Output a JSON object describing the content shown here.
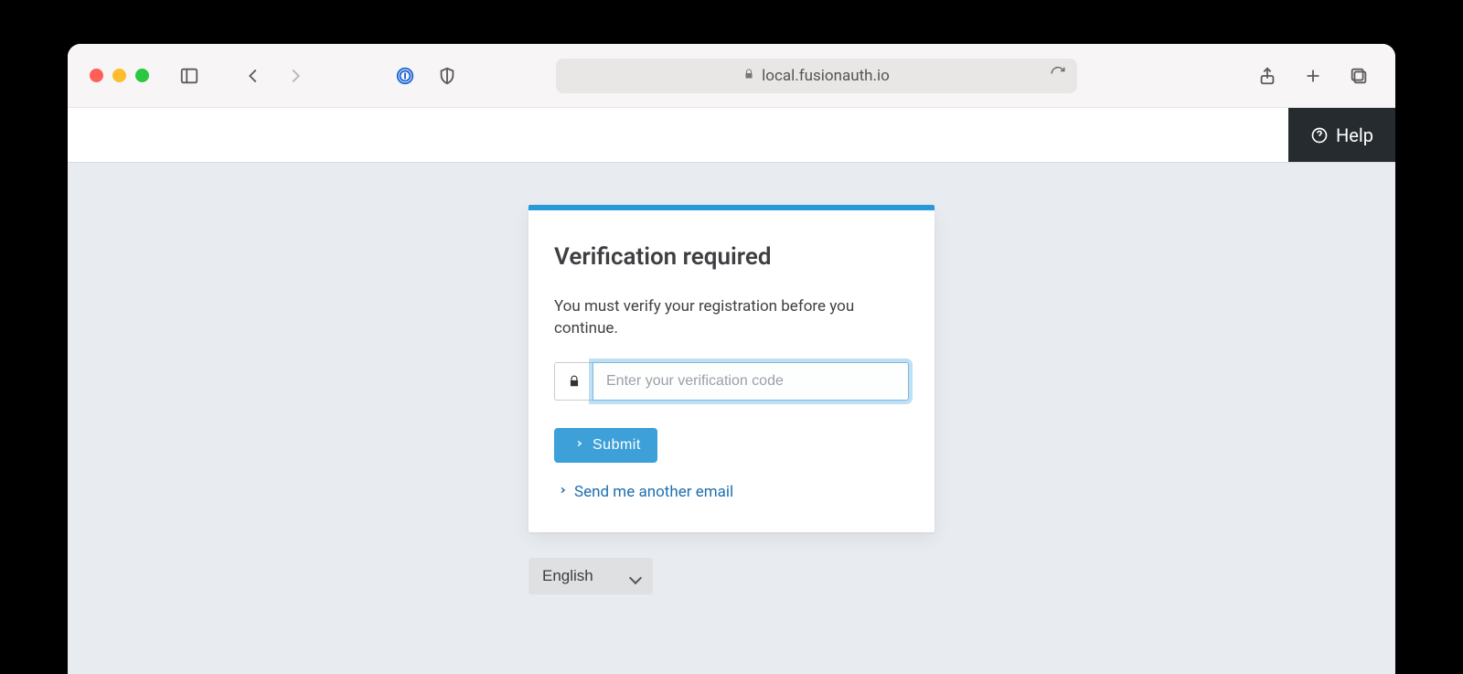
{
  "browser": {
    "url_display": "local.fusionauth.io"
  },
  "appbar": {
    "help_label": "Help"
  },
  "panel": {
    "title": "Verification required",
    "message": "You must verify your registration before you continue.",
    "code_placeholder": "Enter your verification code",
    "code_value": "",
    "submit_label": "Submit",
    "resend_label": "Send me another email"
  },
  "language": {
    "selected": "English",
    "options": [
      "English"
    ]
  }
}
